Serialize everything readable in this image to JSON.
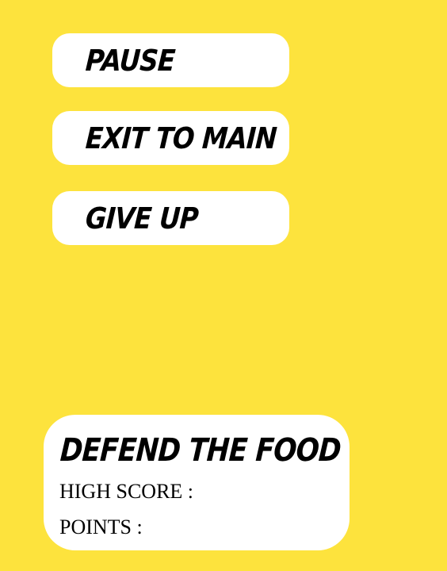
{
  "menu": {
    "pause_label": "PAUSE",
    "exit_label": "EXIT TO MAIN",
    "give_up_label": "GIVE UP"
  },
  "score_panel": {
    "title": "DEFEND THE FOOD",
    "high_score_label": "HIGH SCORE :",
    "points_label": "POINTS :"
  },
  "colors": {
    "background": "#fde33d",
    "panel": "#ffffff",
    "text": "#000000"
  }
}
